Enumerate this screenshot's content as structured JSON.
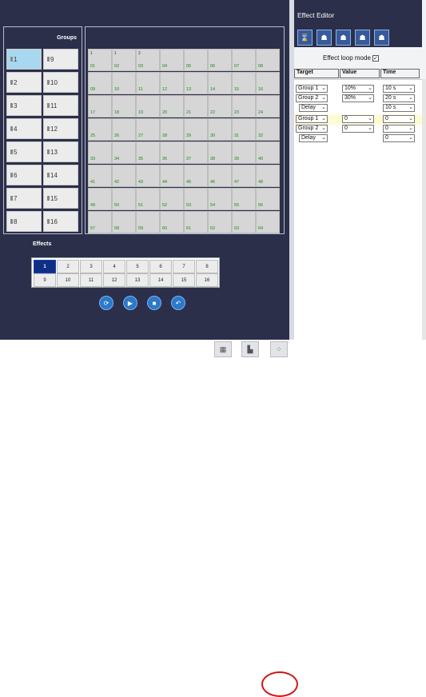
{
  "groups_panel": {
    "title": "Groups",
    "buttons": [
      "1",
      "9",
      "2",
      "10",
      "3",
      "11",
      "4",
      "12",
      "5",
      "13",
      "6",
      "14",
      "7",
      "15",
      "8",
      "16"
    ],
    "selected": "1"
  },
  "cells": {
    "labels": [
      "01",
      "02",
      "03",
      "04",
      "05",
      "06",
      "07",
      "08",
      "09",
      "10",
      "11",
      "12",
      "13",
      "14",
      "15",
      "16",
      "17",
      "18",
      "19",
      "20",
      "21",
      "22",
      "23",
      "24",
      "25",
      "26",
      "27",
      "28",
      "29",
      "30",
      "31",
      "32",
      "33",
      "34",
      "35",
      "36",
      "37",
      "38",
      "39",
      "40",
      "41",
      "42",
      "43",
      "44",
      "45",
      "46",
      "47",
      "48",
      "49",
      "50",
      "51",
      "52",
      "53",
      "54",
      "55",
      "56",
      "57",
      "58",
      "59",
      "60",
      "61",
      "62",
      "63",
      "64"
    ],
    "markers": {
      "c1": "1",
      "c2": "1",
      "c3": "2"
    }
  },
  "effects": {
    "title": "Effects",
    "buttons": [
      "1",
      "2",
      "3",
      "4",
      "5",
      "6",
      "7",
      "8",
      "9",
      "10",
      "11",
      "12",
      "13",
      "14",
      "15",
      "16"
    ],
    "selected": "1"
  },
  "editor": {
    "title": "Effect Editor",
    "loop_label": "Effect loop mode",
    "loop_checked": "✓",
    "headers": {
      "target": "Target",
      "value": "Value",
      "time": "Time"
    },
    "rows": [
      {
        "target": "Group 1",
        "value": "10%",
        "time": "10 s"
      },
      {
        "target": "Group 2",
        "value": "30%",
        "time": "20 s"
      },
      {
        "target": "Delay",
        "value": "",
        "time": "10 s"
      },
      {
        "target": "Group 1",
        "value": "0",
        "time": "0"
      },
      {
        "target": "Group 2",
        "value": "0",
        "time": "0"
      },
      {
        "target": "Delay",
        "value": "",
        "time": "0"
      }
    ]
  }
}
